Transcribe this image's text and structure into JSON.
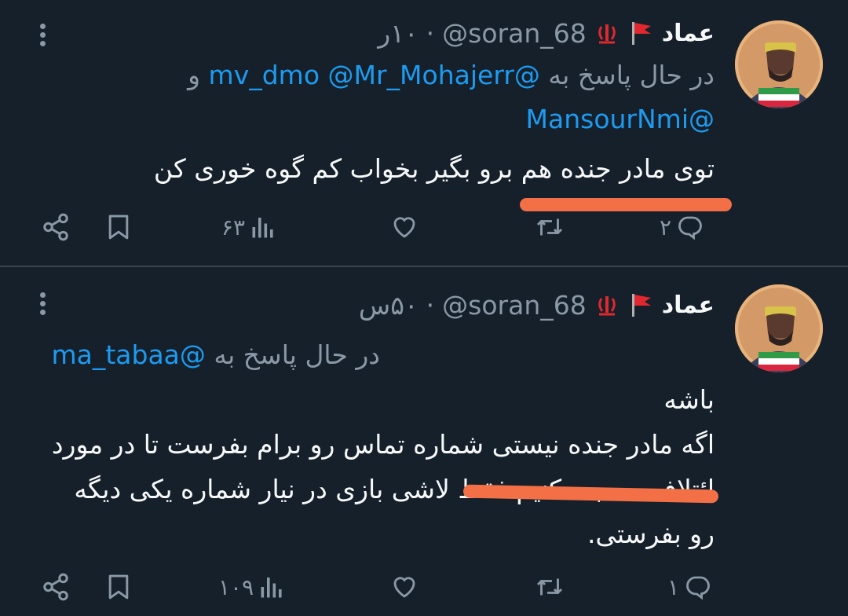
{
  "colors": {
    "background": "#15202b",
    "text": "#f7f9f9",
    "muted": "#8b98a5",
    "link": "#1d9bf0",
    "scribble": "#f36f45"
  },
  "tweets": [
    {
      "author_name": "عماد",
      "handle": "@soran_68",
      "separator": "·",
      "time": "۱۰ر",
      "reply_prefix": "در حال پاسخ به",
      "mentions": [
        "@Mr_Mohajerr",
        "@mv_dmo",
        "@MansourNmi"
      ],
      "conjunction": "و",
      "body_lines": [
        "توی مادر جنده هم برو بگیر بخواب کم گوه خوری کن"
      ],
      "actions": {
        "replies": "۲",
        "views": "۶۳"
      }
    },
    {
      "author_name": "عماد",
      "handle": "@soran_68",
      "separator": "·",
      "time": "۵۰س",
      "reply_prefix": "در حال پاسخ به",
      "mentions": [
        "@ma_tabaa"
      ],
      "body_lines": [
        "باشه",
        "اگه مادر جنده نیستی شماره تماس رو برام بفرست تا در مورد",
        "ائتلاف صحبت کنیم فقط لاشی بازی در نیار شماره یکی دیگه",
        "رو بفرستی."
      ],
      "actions": {
        "replies": "۱",
        "views": "۱۰۹"
      }
    }
  ],
  "icons": [
    "more-icon",
    "flag-icon",
    "iran-emblem-icon",
    "reply-icon",
    "retweet-icon",
    "like-icon",
    "views-icon",
    "bookmark-icon",
    "share-icon"
  ]
}
